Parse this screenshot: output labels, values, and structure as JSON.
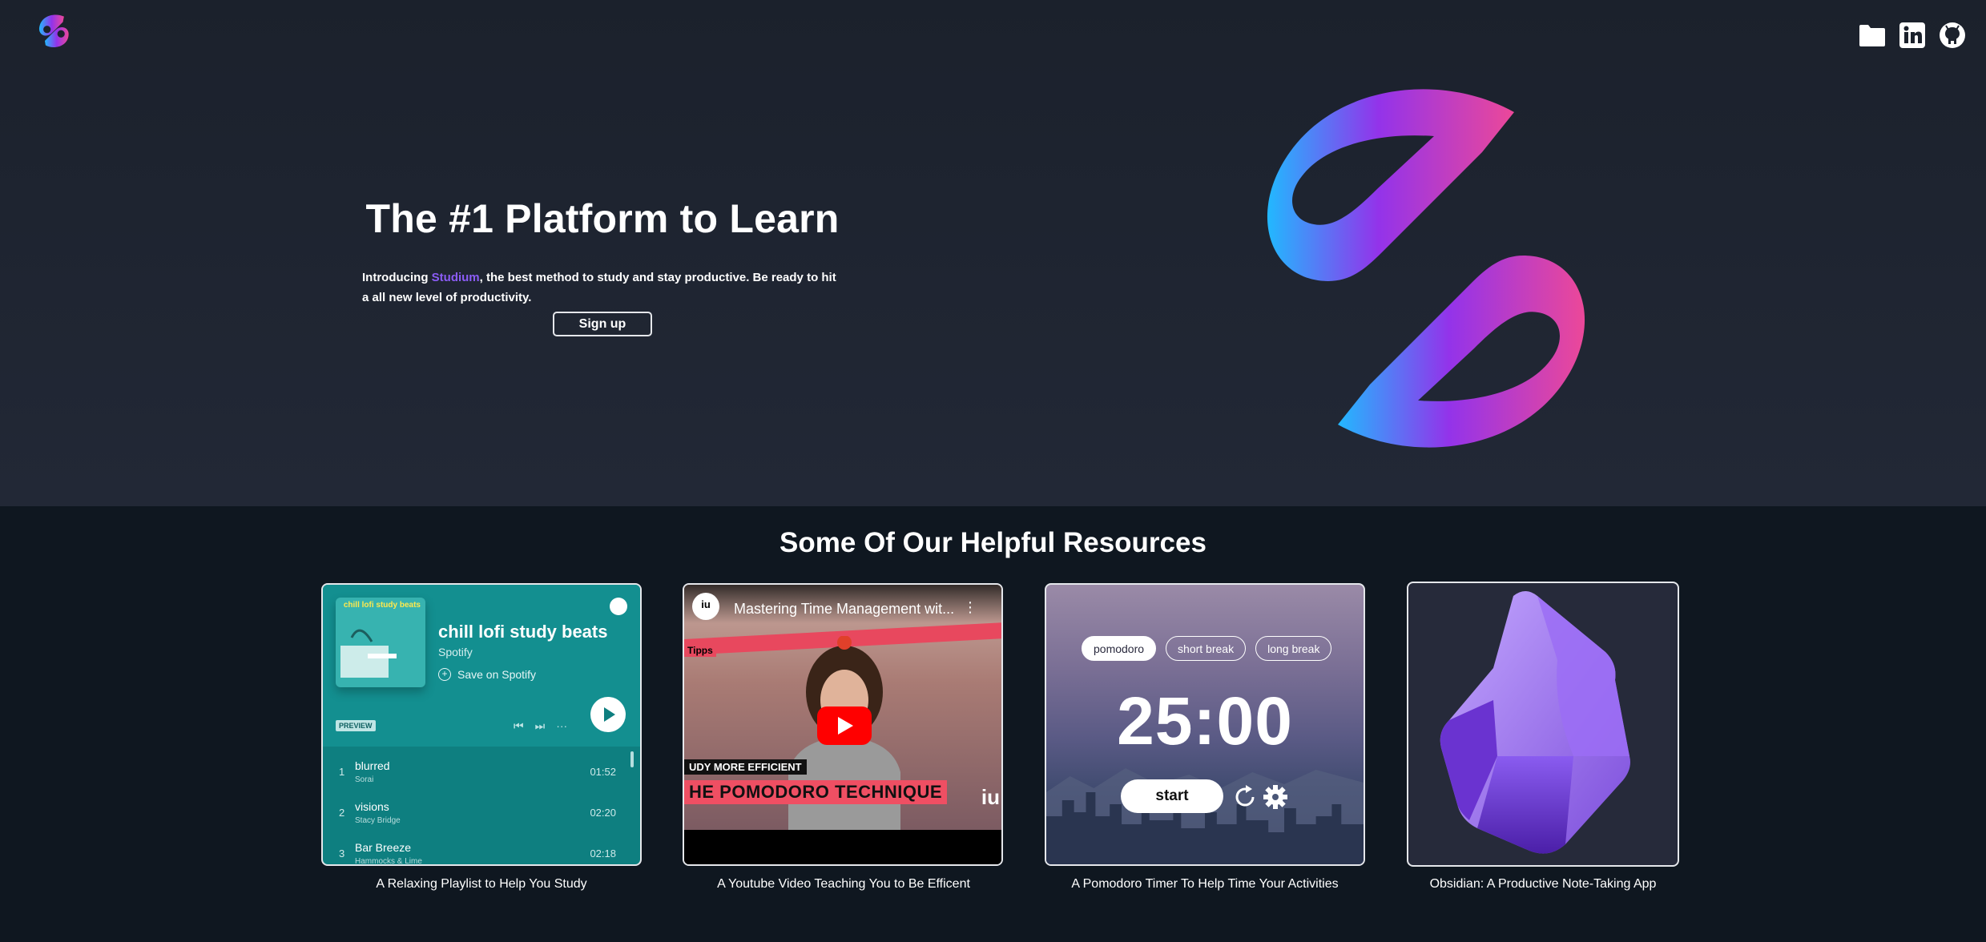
{
  "header": {
    "icons": [
      "folder-icon",
      "linkedin-icon",
      "github-icon"
    ]
  },
  "hero": {
    "title": "The #1 Platform to Learn",
    "desc_prefix": "Introducing ",
    "brand": "Studium",
    "desc_suffix": ", the best method to study and stay productive. Be ready to hit a all new level of productivity.",
    "signup_label": "Sign up"
  },
  "colors": {
    "accent": "#8b5cf6",
    "gradient": [
      "#22b8ff",
      "#9333ea",
      "#ec4899"
    ]
  },
  "resources": {
    "title": "Some Of Our Helpful Resources",
    "captions": [
      "A Relaxing Playlist to Help You Study",
      "A Youtube Video Teaching You to Be Efficent",
      "A Pomodoro Timer To Help Time Your Activities",
      "Obsidian: A Productive Note-Taking App"
    ]
  },
  "spotify": {
    "art_text": "chill lofi study beats",
    "title": "chill lofi study beats",
    "artist": "Spotify",
    "save_label": "Save on Spotify",
    "preview_label": "PREVIEW",
    "tracks": [
      {
        "num": "1",
        "name": "blurred",
        "artist": "Sorai",
        "dur": "01:52"
      },
      {
        "num": "2",
        "name": "visions",
        "artist": "Stacy Bridge",
        "dur": "02:20"
      },
      {
        "num": "3",
        "name": "Bar Breeze",
        "artist": "Hammocks & Lime",
        "dur": "02:18"
      }
    ]
  },
  "youtube": {
    "channel": "iu",
    "title": "Mastering Time Management wit...",
    "tipps": "Tipps",
    "study_text": "UDY MORE EFFICIENT",
    "technique_text": "HE POMODORO TECHNIQUE",
    "corner_text": "iu"
  },
  "pomodoro": {
    "tabs": [
      "pomodoro",
      "short break",
      "long break"
    ],
    "time": "25:00",
    "start_label": "start"
  }
}
